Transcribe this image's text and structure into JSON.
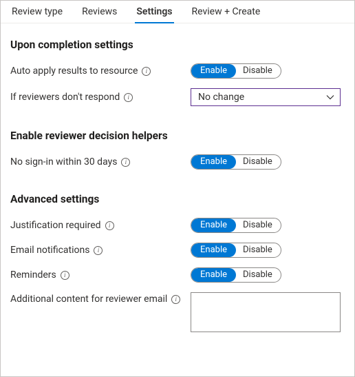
{
  "tabs": {
    "review_type": "Review type",
    "reviews": "Reviews",
    "settings": "Settings",
    "review_create": "Review + Create"
  },
  "toggle": {
    "enable": "Enable",
    "disable": "Disable"
  },
  "section1": {
    "title": "Upon completion settings",
    "auto_apply": "Auto apply results to resource",
    "no_respond": "If reviewers don't respond",
    "no_respond_value": "No change"
  },
  "section2": {
    "title": "Enable reviewer decision helpers",
    "no_signin": "No sign-in within 30 days"
  },
  "section3": {
    "title": "Advanced settings",
    "justification": "Justification required",
    "email_notif": "Email notifications",
    "reminders": "Reminders",
    "additional": "Additional content for reviewer email",
    "additional_value": ""
  }
}
